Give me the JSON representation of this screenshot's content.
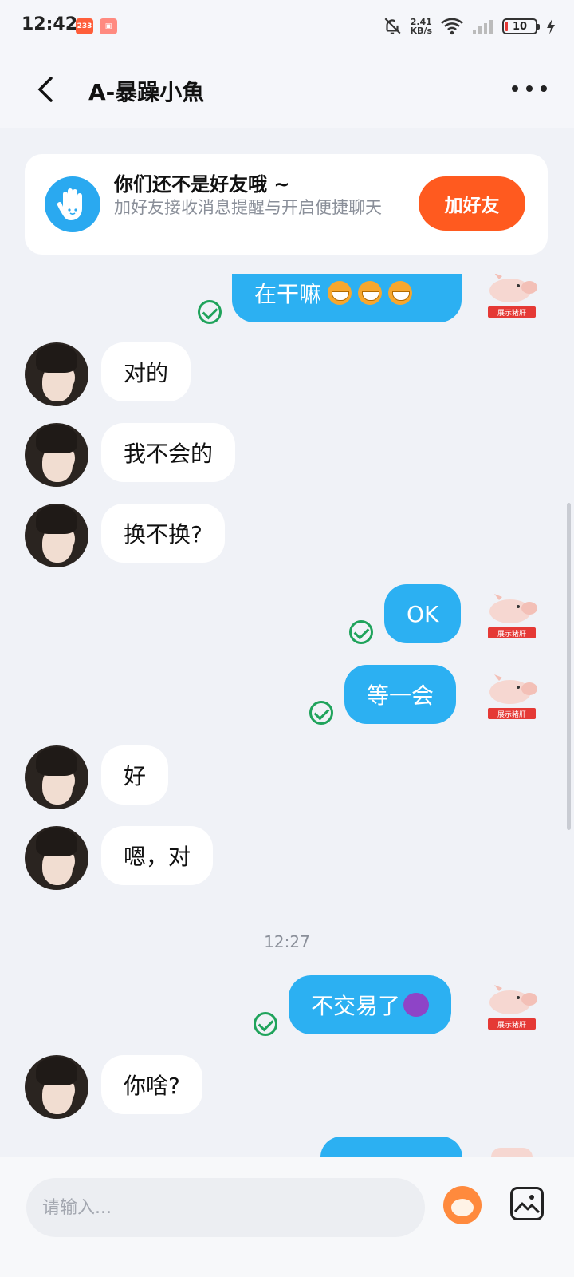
{
  "status_bar": {
    "time": "12:42",
    "badges": [
      "233"
    ],
    "net_speed_value": "2.41",
    "net_speed_unit": "KB/s",
    "battery": "10"
  },
  "header": {
    "title": "A-暴躁小魚"
  },
  "friend_card": {
    "title": "你们还不是好友哦 ~",
    "subtitle": "加好友接收消息提醒与开启便捷聊天",
    "button": "加好友"
  },
  "messages": [
    {
      "side": "out",
      "text": "在干嘛",
      "sent": true
    },
    {
      "side": "in",
      "text": "对的"
    },
    {
      "side": "in",
      "text": "我不会的"
    },
    {
      "side": "in",
      "text": "换不换?"
    },
    {
      "side": "out",
      "text": "OK",
      "sent": true
    },
    {
      "side": "out",
      "text": "等一会",
      "sent": true
    },
    {
      "side": "in",
      "text": "好"
    },
    {
      "side": "in",
      "text": "嗯，对"
    },
    {
      "side": "out",
      "text": "不交易了",
      "sent": true
    },
    {
      "side": "in",
      "text": "你啥?"
    }
  ],
  "timestamp": "12:27",
  "pig_label": "展示猪肝",
  "input": {
    "placeholder": "请输入..."
  },
  "colors": {
    "accent": "#2cb0f2",
    "add_friend": "#ff5a1f",
    "sent_check": "#1fa35b"
  }
}
